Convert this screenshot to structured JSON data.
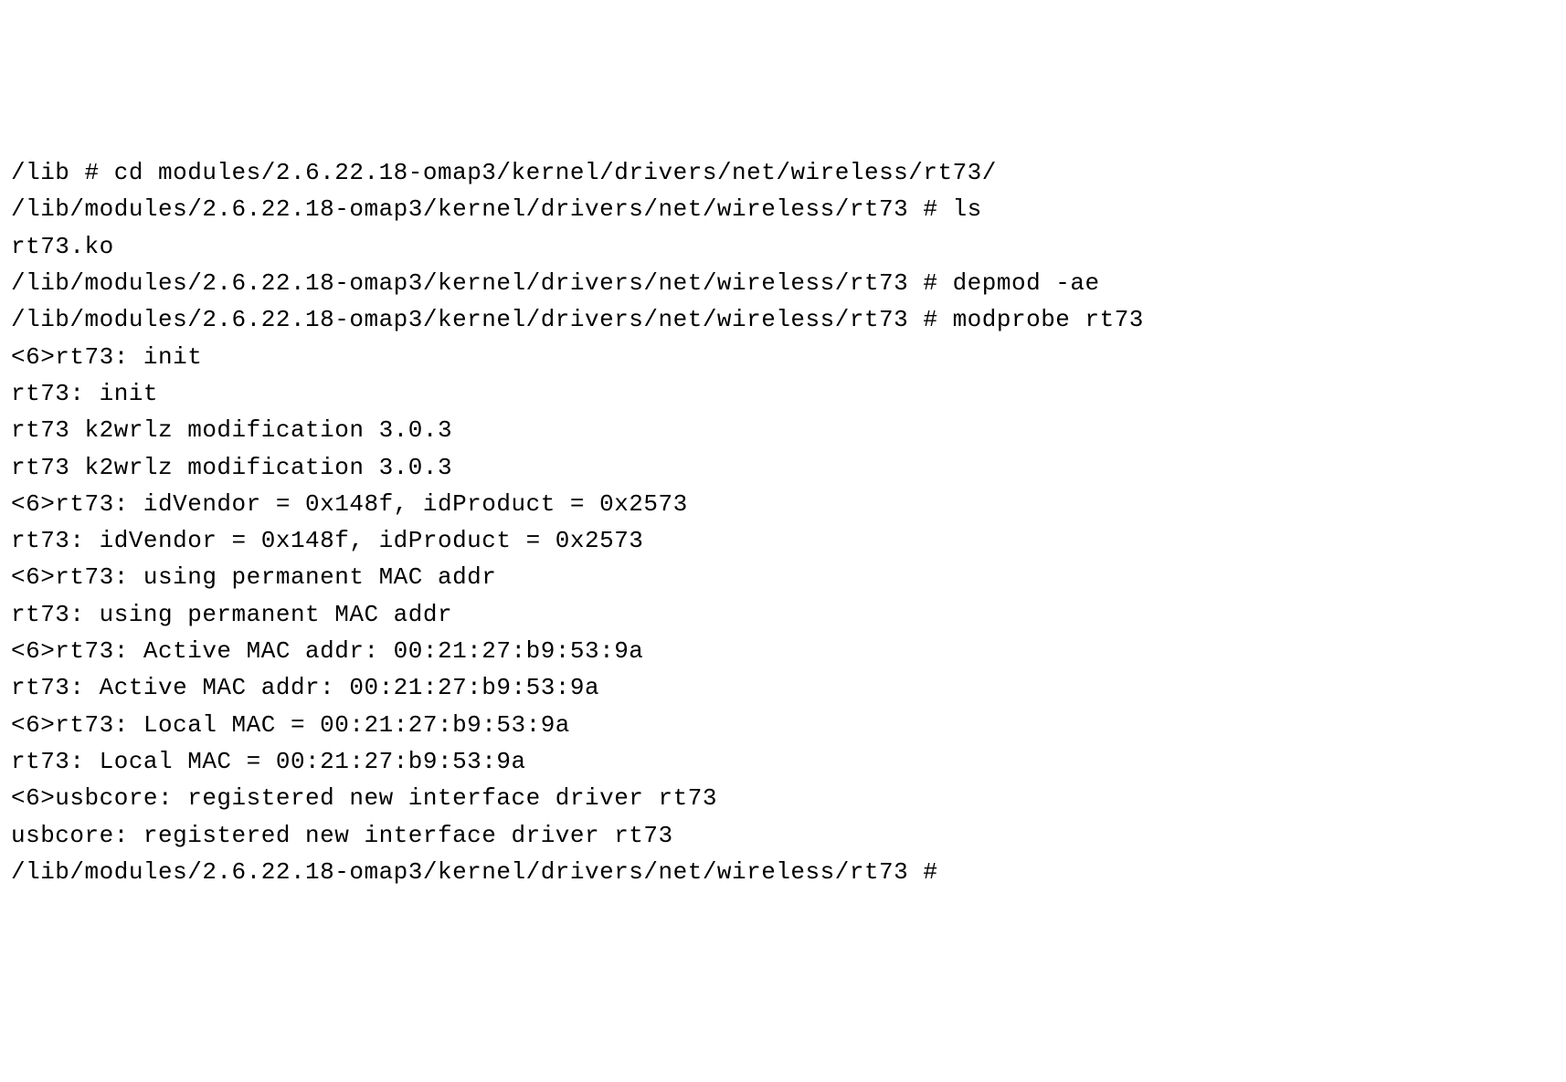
{
  "lines": [
    {
      "type": "prompt",
      "path": "/lib",
      "hash": " # ",
      "command": "cd modules/2.6.22.18-omap3/kernel/drivers/net/wireless/rt73/"
    },
    {
      "type": "prompt",
      "path": "/lib/modules/2.6.22.18-omap3/kernel/drivers/net/wireless/rt73",
      "hash": " # ",
      "command": "ls"
    },
    {
      "type": "output",
      "text": "rt73.ko"
    },
    {
      "type": "prompt",
      "path": "/lib/modules/2.6.22.18-omap3/kernel/drivers/net/wireless/rt73",
      "hash": " # ",
      "command": "depmod -ae"
    },
    {
      "type": "prompt",
      "path": "/lib/modules/2.6.22.18-omap3/kernel/drivers/net/wireless/rt73",
      "hash": " # ",
      "command": "modprobe rt73"
    },
    {
      "type": "output",
      "text": "<6>rt73: init"
    },
    {
      "type": "output",
      "text": "rt73: init"
    },
    {
      "type": "output",
      "text": "rt73 k2wrlz modification 3.0.3"
    },
    {
      "type": "output",
      "text": "rt73 k2wrlz modification 3.0.3"
    },
    {
      "type": "output",
      "text": "<6>rt73: idVendor = 0x148f, idProduct = 0x2573"
    },
    {
      "type": "output",
      "text": "rt73: idVendor = 0x148f, idProduct = 0x2573"
    },
    {
      "type": "output",
      "text": "<6>rt73: using permanent MAC addr"
    },
    {
      "type": "output",
      "text": "rt73: using permanent MAC addr"
    },
    {
      "type": "output",
      "text": "<6>rt73: Active MAC addr: 00:21:27:b9:53:9a"
    },
    {
      "type": "output",
      "text": "rt73: Active MAC addr: 00:21:27:b9:53:9a"
    },
    {
      "type": "output",
      "text": "<6>rt73: Local MAC = 00:21:27:b9:53:9a"
    },
    {
      "type": "output",
      "text": "rt73: Local MAC = 00:21:27:b9:53:9a"
    },
    {
      "type": "output",
      "text": "<6>usbcore: registered new interface driver rt73"
    },
    {
      "type": "output",
      "text": "usbcore: registered new interface driver rt73"
    },
    {
      "type": "prompt",
      "path": "/lib/modules/2.6.22.18-omap3/kernel/drivers/net/wireless/rt73",
      "hash": " # ",
      "command": ""
    }
  ]
}
